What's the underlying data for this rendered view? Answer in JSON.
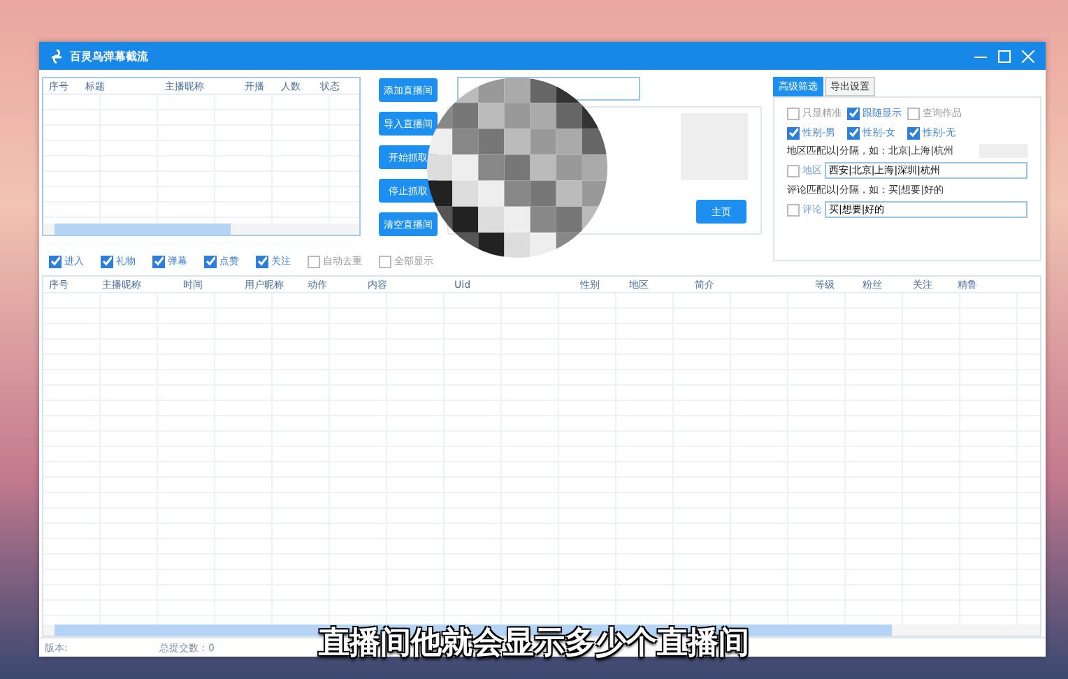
{
  "window": {
    "title": "百灵鸟弹幕截流"
  },
  "room_table": {
    "columns": [
      "序号",
      "标题",
      "主播昵称",
      "开播",
      "人数",
      "状态"
    ]
  },
  "actions": [
    "添加直播间",
    "导入直播间",
    "开始抓取",
    "停止抓取",
    "清空直播间"
  ],
  "home_button": "主页",
  "filter_tabs": [
    {
      "label": "高级筛选",
      "selected": true
    },
    {
      "label": "导出设置",
      "selected": false
    }
  ],
  "filter_options": [
    {
      "label": "只显精准",
      "checked": false
    },
    {
      "label": "跟随显示",
      "checked": true
    },
    {
      "label": "查询作品",
      "checked": false
    },
    {
      "label": "性别-男",
      "checked": true
    },
    {
      "label": "性别-女",
      "checked": true
    },
    {
      "label": "性别-无",
      "checked": true
    }
  ],
  "region_hint": "地区匹配以|分隔，如：北京|上海|杭州",
  "region_filter": {
    "label": "地区",
    "checked": false,
    "value": "西安|北京|上海|深圳|杭州"
  },
  "comment_hint": "评论匹配以|分隔，如：买|想要|好的",
  "comment_filter": {
    "label": "评论",
    "checked": false,
    "value": "买|想要|好的"
  },
  "event_filters": [
    {
      "label": "进入",
      "checked": true
    },
    {
      "label": "礼物",
      "checked": true
    },
    {
      "label": "弹幕",
      "checked": true
    },
    {
      "label": "点赞",
      "checked": true
    },
    {
      "label": "关注",
      "checked": true
    },
    {
      "label": "自动去重",
      "checked": false
    },
    {
      "label": "全部显示",
      "checked": false
    }
  ],
  "message_table": {
    "columns": [
      "序号",
      "主播昵称",
      "时间",
      "用户昵称",
      "动作",
      "内容",
      "Uid",
      "性别",
      "地区",
      "简介",
      "等级",
      "粉丝",
      "关注",
      "精鲁"
    ]
  },
  "status_bar": {
    "version": "版本:",
    "total": "总提交数：0"
  },
  "subtitle": "直播间他就会显示多少个直播间"
}
